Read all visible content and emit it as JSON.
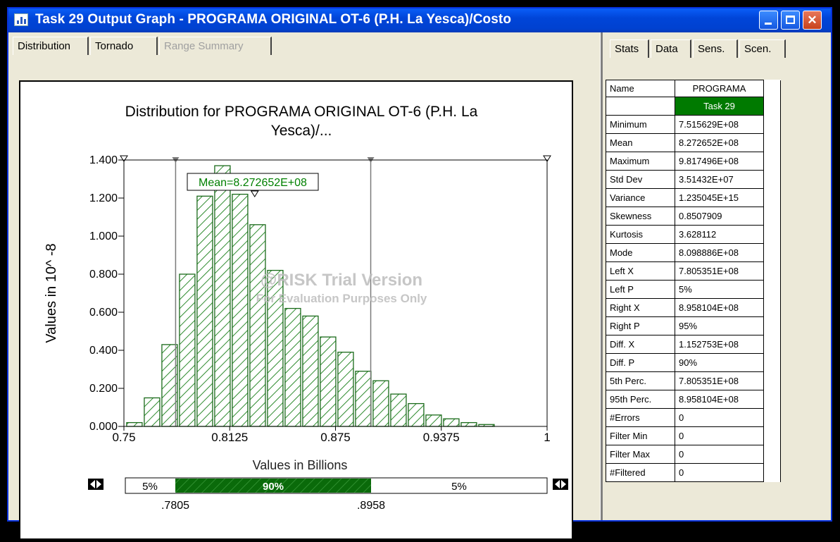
{
  "window": {
    "title": "Task 29 Output Graph - PROGRAMA ORIGINAL OT-6 (P.H. La Yesca)/Costo"
  },
  "left_tabs": [
    {
      "label": "Distribution",
      "active": true
    },
    {
      "label": "Tornado"
    },
    {
      "label": "Range Summary",
      "disabled": true
    }
  ],
  "right_tabs": [
    {
      "label": "Stats",
      "active": true
    },
    {
      "label": "Data"
    },
    {
      "label": "Sens."
    },
    {
      "label": "Scen."
    }
  ],
  "watermark": {
    "line1": "@RISK Trial Version",
    "line2": "For Evaluation Purposes Only"
  },
  "mean_label": "Mean=8.272652E+08",
  "delimiter": {
    "left_pct": "5%",
    "mid_pct": "90%",
    "right_pct": "5%",
    "left_value": ".7805",
    "right_value": ".8958"
  },
  "chart_data": {
    "type": "bar",
    "title": "Distribution for PROGRAMA ORIGINAL OT-6 (P.H. La Yesca)/...",
    "title_line1": "Distribution for PROGRAMA ORIGINAL OT-6 (P.H. La",
    "title_line2": "Yesca)/...",
    "xlabel": "Values in Billions",
    "ylabel": "Values in 10^ -8",
    "xlim": [
      0.75,
      1.0
    ],
    "ylim": [
      0,
      1.4
    ],
    "x_ticks": [
      "0.75",
      "0.8125",
      "0.875",
      "0.9375",
      "1"
    ],
    "y_ticks": [
      "0.000",
      "0.200",
      "0.400",
      "0.600",
      "0.800",
      "1.000",
      "1.200",
      "1.400"
    ],
    "bin_width": 0.0104,
    "bin_starts": [
      0.751,
      0.7614,
      0.7718,
      0.7822,
      0.7926,
      0.803,
      0.8134,
      0.8238,
      0.8342,
      0.8446,
      0.855,
      0.8654,
      0.8758,
      0.8862,
      0.8966,
      0.907,
      0.9174,
      0.9278,
      0.9382,
      0.9486,
      0.959,
      0.9694
    ],
    "values": [
      0.02,
      0.15,
      0.43,
      0.8,
      1.21,
      1.37,
      1.22,
      1.06,
      0.82,
      0.62,
      0.58,
      0.47,
      0.39,
      0.29,
      0.24,
      0.17,
      0.12,
      0.06,
      0.04,
      0.02,
      0.01,
      0.0
    ],
    "markers": {
      "mean": 0.8272652,
      "left_x": 0.7805351,
      "right_x": 0.8958104
    },
    "grid": false,
    "fill": "green-hatch"
  },
  "stats": {
    "header_name": "Name",
    "column_name": "PROGRAMA",
    "column_task": "Task 29",
    "rows": [
      {
        "label": "Minimum",
        "value": "7.515629E+08"
      },
      {
        "label": "Mean",
        "value": "8.272652E+08"
      },
      {
        "label": "Maximum",
        "value": "9.817496E+08"
      },
      {
        "label": "Std Dev",
        "value": "3.51432E+07"
      },
      {
        "label": "Variance",
        "value": "1.235045E+15"
      },
      {
        "label": "Skewness",
        "value": "0.8507909"
      },
      {
        "label": "Kurtosis",
        "value": "3.628112"
      },
      {
        "label": "Mode",
        "value": "8.098886E+08"
      },
      {
        "label": "Left X",
        "value": "7.805351E+08"
      },
      {
        "label": "Left P",
        "value": "5%"
      },
      {
        "label": "Right X",
        "value": "8.958104E+08"
      },
      {
        "label": "Right P",
        "value": "95%"
      },
      {
        "label": "Diff. X",
        "value": "1.152753E+08"
      },
      {
        "label": "Diff. P",
        "value": "90%"
      },
      {
        "label": "5th Perc.",
        "value": "7.805351E+08"
      },
      {
        "label": "95th Perc.",
        "value": "8.958104E+08"
      },
      {
        "label": "#Errors",
        "value": "0"
      },
      {
        "label": "Filter Min",
        "value": "0"
      },
      {
        "label": "Filter Max",
        "value": "0"
      },
      {
        "label": "#Filtered",
        "value": "0"
      }
    ]
  },
  "colors": {
    "title_bar": "#0045d8",
    "bar_stroke": "#1a7a1a",
    "hatch": "#2e8b2e",
    "delimiter_fill": "#006a00",
    "mean_label": "#008000"
  }
}
